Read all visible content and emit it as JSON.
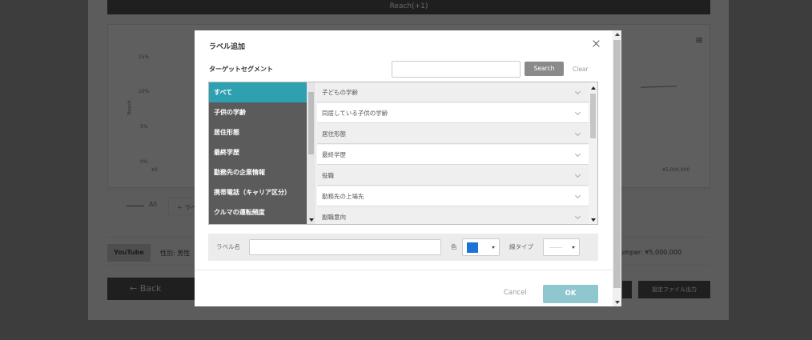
{
  "background": {
    "header_label": "Reach(+1)",
    "y_ticks": [
      "15%",
      "10%",
      "5%",
      "0%"
    ],
    "y_title": "Reach",
    "x_ticks": [
      "¥0",
      "¥5,000,000"
    ],
    "legend_all": "All",
    "legend_add": "+ ラベ",
    "youtube_badge": "YouTube",
    "sex_text": "性別: 男性",
    "bumper_text": "umper: ¥5,000,000",
    "back_label": "← Back",
    "export_label": "設定ファイル出力"
  },
  "modal": {
    "title": "ラベル追加",
    "segment_label": "ターゲットセグメント",
    "search": {
      "placeholder": "",
      "button_label": "Search",
      "clear_label": "Clear"
    },
    "categories": [
      {
        "label": "すべて",
        "active": true
      },
      {
        "label": "子供の学齢"
      },
      {
        "label": "居住形態"
      },
      {
        "label": "最終学歴"
      },
      {
        "label": "勤務先の企業情報"
      },
      {
        "label": "携帯電話（キャリア区分）"
      },
      {
        "label": "クルマの運転頻度"
      }
    ],
    "subcategories": [
      {
        "label": "子どもの学齢"
      },
      {
        "label": "同居している子供の学齢"
      },
      {
        "label": "居住形態"
      },
      {
        "label": "最終学歴"
      },
      {
        "label": "役職"
      },
      {
        "label": "勤務先の上場先"
      },
      {
        "label": "副職意向"
      }
    ],
    "label_name": {
      "label": "ラベル名",
      "value": ""
    },
    "color": {
      "label": "色",
      "value": "#1a73d6"
    },
    "line_type": {
      "label": "線タイプ"
    },
    "cancel_label": "Cancel",
    "ok_label": "OK"
  }
}
